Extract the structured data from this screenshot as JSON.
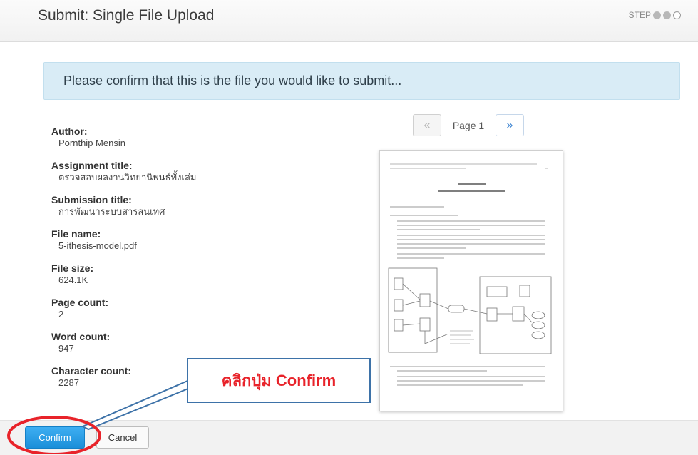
{
  "header": {
    "title": "Submit: Single File Upload",
    "step_label": "STEP",
    "step_current": 3,
    "step_total": 3
  },
  "banner": {
    "text": "Please confirm that this is the file you would like to submit..."
  },
  "meta": {
    "author_label": "Author:",
    "author": "Pornthip Mensin",
    "assignment_label": "Assignment title:",
    "assignment": "ตรวจสอบผลงานวิทยานิพนธ์ทั้งเล่ม",
    "submission_label": "Submission title:",
    "submission": "การพัฒนาระบบสารสนเทศ",
    "filename_label": "File name:",
    "filename": "5-ithesis-model.pdf",
    "filesize_label": "File size:",
    "filesize": "624.1K",
    "pagecount_label": "Page count:",
    "pagecount": "2",
    "wordcount_label": "Word count:",
    "wordcount": "947",
    "charcount_label": "Character count:",
    "charcount": "2287"
  },
  "pager": {
    "prev_glyph": "«",
    "page_label": "Page 1",
    "next_glyph": "»"
  },
  "footer": {
    "confirm_label": "Confirm",
    "cancel_label": "Cancel"
  },
  "annotation": {
    "callout_text": "คลิกปุ่ม Confirm",
    "callout_color": "#e8232a",
    "highlight_color": "#e8232a"
  },
  "colors": {
    "accent": "#1b8fd9",
    "banner_bg": "#d9ecf6"
  }
}
